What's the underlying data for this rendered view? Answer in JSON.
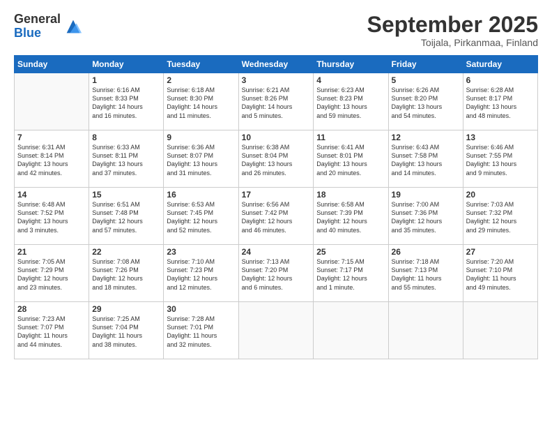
{
  "logo": {
    "general": "General",
    "blue": "Blue"
  },
  "header": {
    "month": "September 2025",
    "location": "Toijala, Pirkanmaa, Finland"
  },
  "weekdays": [
    "Sunday",
    "Monday",
    "Tuesday",
    "Wednesday",
    "Thursday",
    "Friday",
    "Saturday"
  ],
  "weeks": [
    [
      {
        "day": "",
        "info": ""
      },
      {
        "day": "1",
        "info": "Sunrise: 6:16 AM\nSunset: 8:33 PM\nDaylight: 14 hours\nand 16 minutes."
      },
      {
        "day": "2",
        "info": "Sunrise: 6:18 AM\nSunset: 8:30 PM\nDaylight: 14 hours\nand 11 minutes."
      },
      {
        "day": "3",
        "info": "Sunrise: 6:21 AM\nSunset: 8:26 PM\nDaylight: 14 hours\nand 5 minutes."
      },
      {
        "day": "4",
        "info": "Sunrise: 6:23 AM\nSunset: 8:23 PM\nDaylight: 13 hours\nand 59 minutes."
      },
      {
        "day": "5",
        "info": "Sunrise: 6:26 AM\nSunset: 8:20 PM\nDaylight: 13 hours\nand 54 minutes."
      },
      {
        "day": "6",
        "info": "Sunrise: 6:28 AM\nSunset: 8:17 PM\nDaylight: 13 hours\nand 48 minutes."
      }
    ],
    [
      {
        "day": "7",
        "info": "Sunrise: 6:31 AM\nSunset: 8:14 PM\nDaylight: 13 hours\nand 42 minutes."
      },
      {
        "day": "8",
        "info": "Sunrise: 6:33 AM\nSunset: 8:11 PM\nDaylight: 13 hours\nand 37 minutes."
      },
      {
        "day": "9",
        "info": "Sunrise: 6:36 AM\nSunset: 8:07 PM\nDaylight: 13 hours\nand 31 minutes."
      },
      {
        "day": "10",
        "info": "Sunrise: 6:38 AM\nSunset: 8:04 PM\nDaylight: 13 hours\nand 26 minutes."
      },
      {
        "day": "11",
        "info": "Sunrise: 6:41 AM\nSunset: 8:01 PM\nDaylight: 13 hours\nand 20 minutes."
      },
      {
        "day": "12",
        "info": "Sunrise: 6:43 AM\nSunset: 7:58 PM\nDaylight: 13 hours\nand 14 minutes."
      },
      {
        "day": "13",
        "info": "Sunrise: 6:46 AM\nSunset: 7:55 PM\nDaylight: 13 hours\nand 9 minutes."
      }
    ],
    [
      {
        "day": "14",
        "info": "Sunrise: 6:48 AM\nSunset: 7:52 PM\nDaylight: 13 hours\nand 3 minutes."
      },
      {
        "day": "15",
        "info": "Sunrise: 6:51 AM\nSunset: 7:48 PM\nDaylight: 12 hours\nand 57 minutes."
      },
      {
        "day": "16",
        "info": "Sunrise: 6:53 AM\nSunset: 7:45 PM\nDaylight: 12 hours\nand 52 minutes."
      },
      {
        "day": "17",
        "info": "Sunrise: 6:56 AM\nSunset: 7:42 PM\nDaylight: 12 hours\nand 46 minutes."
      },
      {
        "day": "18",
        "info": "Sunrise: 6:58 AM\nSunset: 7:39 PM\nDaylight: 12 hours\nand 40 minutes."
      },
      {
        "day": "19",
        "info": "Sunrise: 7:00 AM\nSunset: 7:36 PM\nDaylight: 12 hours\nand 35 minutes."
      },
      {
        "day": "20",
        "info": "Sunrise: 7:03 AM\nSunset: 7:32 PM\nDaylight: 12 hours\nand 29 minutes."
      }
    ],
    [
      {
        "day": "21",
        "info": "Sunrise: 7:05 AM\nSunset: 7:29 PM\nDaylight: 12 hours\nand 23 minutes."
      },
      {
        "day": "22",
        "info": "Sunrise: 7:08 AM\nSunset: 7:26 PM\nDaylight: 12 hours\nand 18 minutes."
      },
      {
        "day": "23",
        "info": "Sunrise: 7:10 AM\nSunset: 7:23 PM\nDaylight: 12 hours\nand 12 minutes."
      },
      {
        "day": "24",
        "info": "Sunrise: 7:13 AM\nSunset: 7:20 PM\nDaylight: 12 hours\nand 6 minutes."
      },
      {
        "day": "25",
        "info": "Sunrise: 7:15 AM\nSunset: 7:17 PM\nDaylight: 12 hours\nand 1 minute."
      },
      {
        "day": "26",
        "info": "Sunrise: 7:18 AM\nSunset: 7:13 PM\nDaylight: 11 hours\nand 55 minutes."
      },
      {
        "day": "27",
        "info": "Sunrise: 7:20 AM\nSunset: 7:10 PM\nDaylight: 11 hours\nand 49 minutes."
      }
    ],
    [
      {
        "day": "28",
        "info": "Sunrise: 7:23 AM\nSunset: 7:07 PM\nDaylight: 11 hours\nand 44 minutes."
      },
      {
        "day": "29",
        "info": "Sunrise: 7:25 AM\nSunset: 7:04 PM\nDaylight: 11 hours\nand 38 minutes."
      },
      {
        "day": "30",
        "info": "Sunrise: 7:28 AM\nSunset: 7:01 PM\nDaylight: 11 hours\nand 32 minutes."
      },
      {
        "day": "",
        "info": ""
      },
      {
        "day": "",
        "info": ""
      },
      {
        "day": "",
        "info": ""
      },
      {
        "day": "",
        "info": ""
      }
    ]
  ]
}
